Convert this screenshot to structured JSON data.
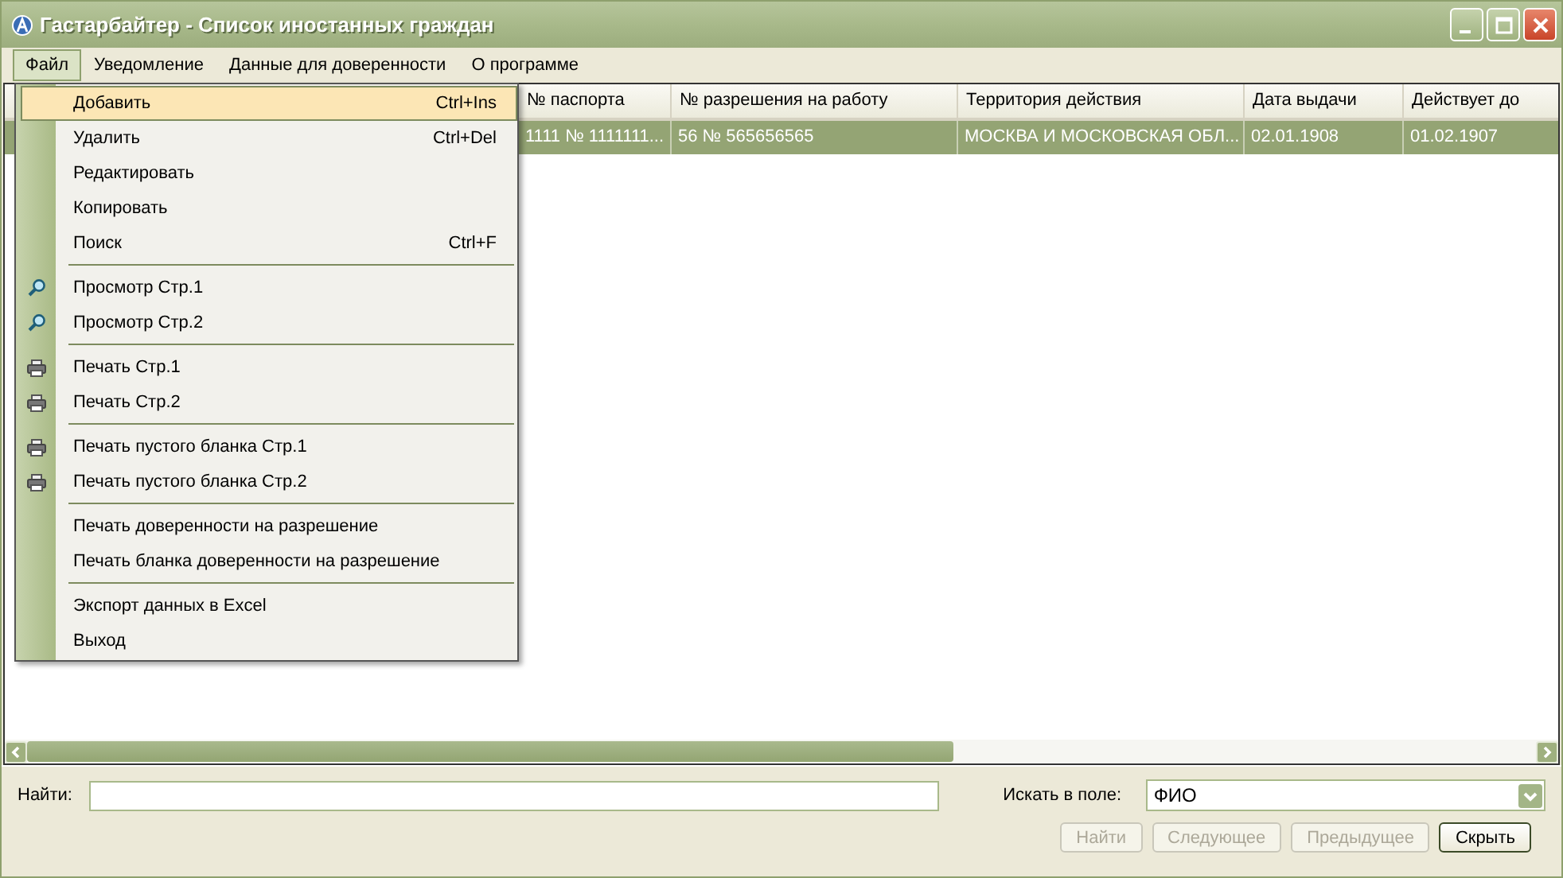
{
  "window": {
    "title": "Гастарбайтер - Список иностанных граждан"
  },
  "menubar": [
    {
      "label": "Файл",
      "selected": true
    },
    {
      "label": "Уведомление",
      "selected": false
    },
    {
      "label": "Данные для доверенности",
      "selected": false
    },
    {
      "label": "О программе",
      "selected": false
    }
  ],
  "file_menu": [
    {
      "kind": "plain",
      "label": "Добавить",
      "shortcut": "Ctrl+Ins",
      "selected": true
    },
    {
      "kind": "plain",
      "label": "Удалить",
      "shortcut": "Ctrl+Del",
      "selected": false
    },
    {
      "kind": "plain",
      "label": "Редактировать",
      "selected": false
    },
    {
      "kind": "plain",
      "label": "Копировать",
      "selected": false
    },
    {
      "kind": "plain",
      "label": "Поиск",
      "shortcut": "Ctrl+F",
      "selected": false
    },
    {
      "kind": "separator"
    },
    {
      "kind": "view",
      "label": "Просмотр Стр.1",
      "selected": false
    },
    {
      "kind": "view",
      "label": "Просмотр Стр.2",
      "selected": false
    },
    {
      "kind": "separator"
    },
    {
      "kind": "print",
      "label": "Печать Стр.1",
      "selected": false
    },
    {
      "kind": "print",
      "label": "Печать Стр.2",
      "selected": false
    },
    {
      "kind": "separator"
    },
    {
      "kind": "print",
      "label": "Печать пустого бланка Стр.1",
      "selected": false
    },
    {
      "kind": "print",
      "label": "Печать пустого бланка Стр.2",
      "selected": false
    },
    {
      "kind": "separator"
    },
    {
      "kind": "plain",
      "label": "Печать доверенности на разрешение",
      "selected": false
    },
    {
      "kind": "plain",
      "label": "Печать бланка доверенности на разрешение",
      "selected": false
    },
    {
      "kind": "separator"
    },
    {
      "kind": "plain",
      "label": "Экспорт данных в Excel",
      "selected": false
    },
    {
      "kind": "plain",
      "label": "Выход",
      "selected": false
    }
  ],
  "table": {
    "columns": [
      "№ паспорта",
      "№ разрешения на работу",
      "Территория действия",
      "Дата выдачи",
      "Действует до"
    ],
    "rows": [
      {
        "cells": [
          "1111 № 1111111...",
          "56 № 565656565",
          "МОСКВА И МОСКОВСКАЯ ОБЛ...",
          "02.01.1908",
          "01.02.1907"
        ],
        "selected": true
      }
    ]
  },
  "search": {
    "label": "Найти:",
    "field_label": "Искать в поле:",
    "field_value": "ФИО"
  },
  "buttons": [
    {
      "label": "Найти",
      "disabled": true
    },
    {
      "label": "Следующее",
      "disabled": true
    },
    {
      "label": "Предыдущее",
      "disabled": true
    },
    {
      "label": "Скрыть",
      "disabled": false
    }
  ]
}
